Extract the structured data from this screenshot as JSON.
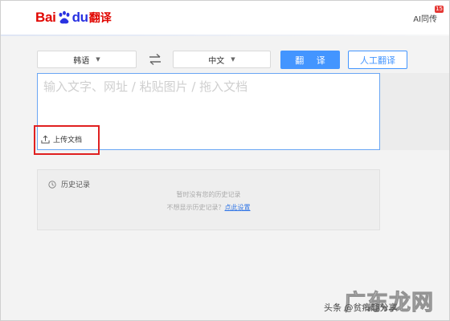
{
  "header": {
    "logo": {
      "bai": "Bai",
      "du": "du",
      "fanyi": "翻译"
    },
    "ai_link": "AI同传",
    "ai_badge": "15"
  },
  "toolbar": {
    "source_language": "韩语",
    "target_language": "中文",
    "translate_label": "翻 译",
    "human_translate_label": "人工翻译"
  },
  "input": {
    "placeholder": "输入文字、网址 / 粘贴图片 / 拖入文档",
    "value": "",
    "upload_label": "上传文档"
  },
  "history": {
    "title": "历史记录",
    "empty_text": "暂时没有您的历史记录",
    "hint_prefix": "不想显示历史记录？",
    "hint_link": "点此设置"
  },
  "watermark": {
    "big_text": "广东龙网",
    "small_text": "头条 @贫瘠趣分享"
  },
  "colors": {
    "brand_red": "#e10601",
    "brand_blue": "#2932e1",
    "accent": "#4395ff",
    "highlight_frame": "#e02020"
  },
  "icons": {
    "swap": "swap-arrows-icon",
    "upload": "upload-icon",
    "history": "clock-icon"
  }
}
